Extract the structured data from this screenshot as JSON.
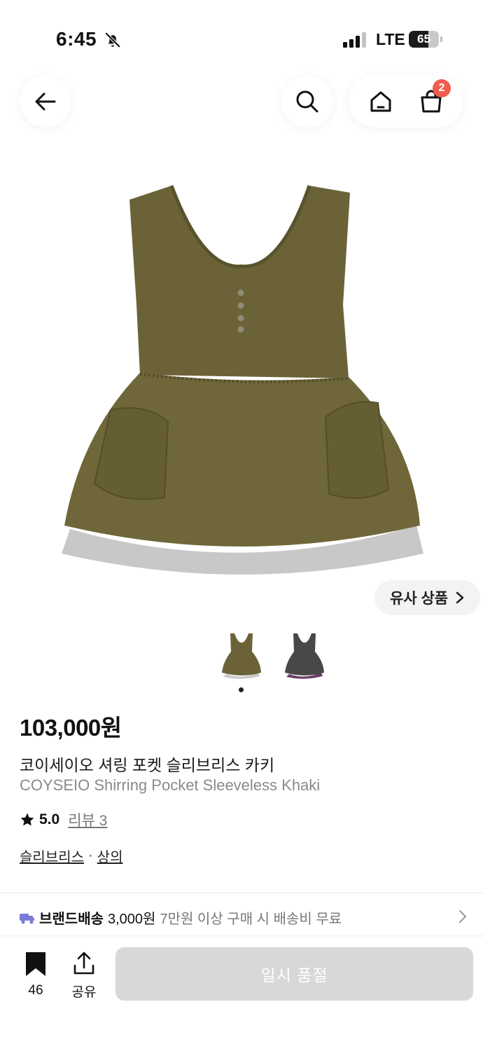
{
  "status_bar": {
    "time": "6:45",
    "network": "LTE",
    "battery": "65",
    "battery_level": 0.65,
    "icons": [
      "bell-slash-icon",
      "signal-icon",
      "battery-icon"
    ]
  },
  "top_nav": {
    "icons": [
      "back-arrow-icon",
      "search-icon",
      "home-icon",
      "cart-icon"
    ],
    "cart_badge": "2"
  },
  "product": {
    "similar_button": "유사 상품",
    "thumbnail_count": 2,
    "price": "103,000원",
    "name_ko": "코이세이오 셔링 포켓 슬리브리스 카키",
    "name_en": "COYSEIO Shirring Pocket Sleeveless Khaki",
    "rating": "5.0",
    "reviews": "리뷰 3",
    "category_1": "슬리브리스",
    "category_sep": "·",
    "category_2": "상의"
  },
  "shipping": {
    "label": "브랜드배송",
    "amount": "3,000원",
    "note": "7만원 이상 구매 시 배송비 무료"
  },
  "bottom_bar": {
    "bookmark_count": "46",
    "share_label": "공유",
    "buy_button": "일시 품절"
  },
  "colors": {
    "badge": "#f25c4f",
    "disabled_button": "#d8d8d8",
    "khaki_product": "#6b6337",
    "truck_icon": "#7b7ad8"
  }
}
